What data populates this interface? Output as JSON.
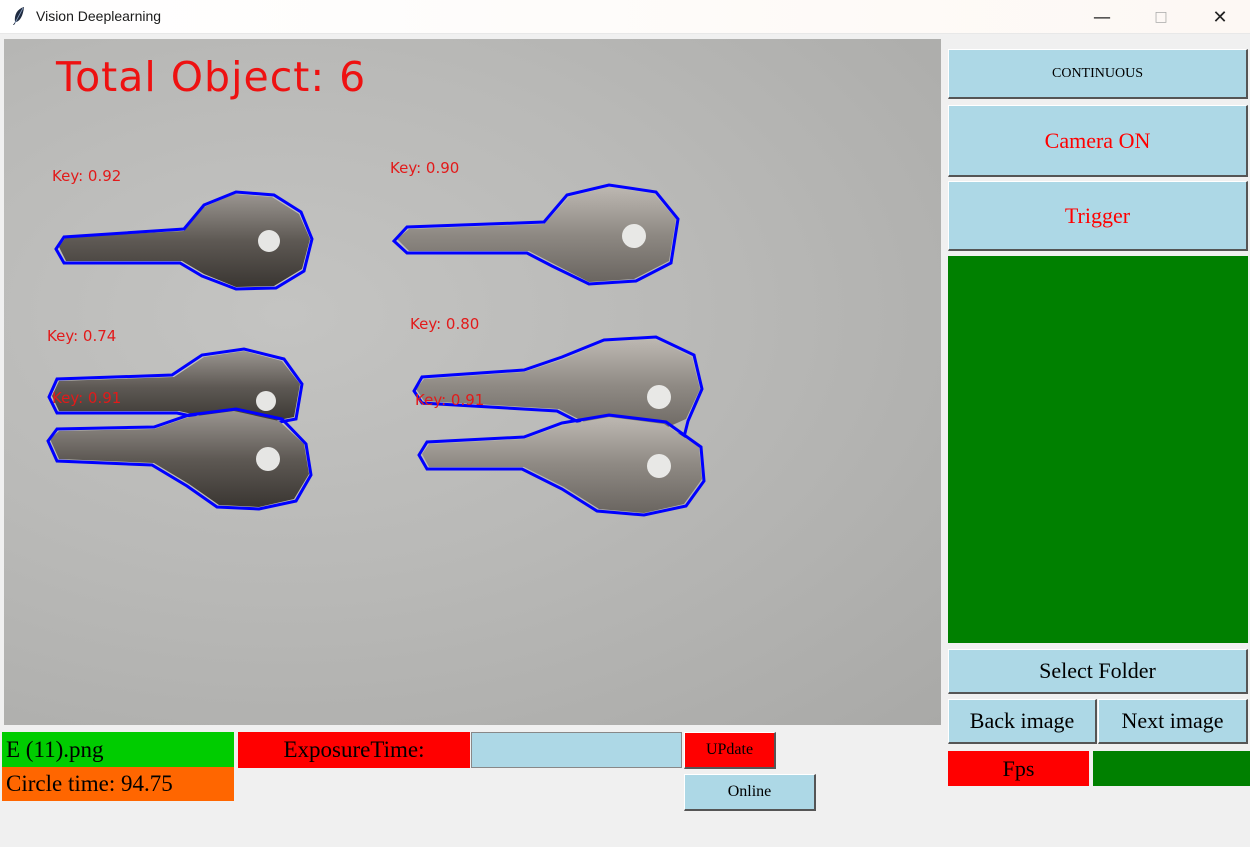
{
  "window": {
    "title": "Vision Deeplearning",
    "minimize_glyph": "—",
    "maximize_glyph": "□",
    "close_glyph": "✕"
  },
  "camera_view": {
    "total_object_text": "Total Object: 6",
    "detections": [
      {
        "label": "Key: 0.92"
      },
      {
        "label": "Key: 0.90"
      },
      {
        "label": "Key: 0.74"
      },
      {
        "label": "Key: 0.80"
      },
      {
        "label": "Key: 0.91"
      },
      {
        "label": "Key: 0.91"
      }
    ],
    "label_color": "#e21a1a",
    "contour_color": "#0000ff"
  },
  "right_panel": {
    "continuous_label": "CONTINUOUS",
    "camera_on_label": "Camera ON",
    "trigger_label": "Trigger",
    "select_folder_label": "Select Folder",
    "back_image_label": "Back image",
    "next_image_label": "Next image",
    "fps_label": "Fps",
    "fps_value": ""
  },
  "bottom_bar": {
    "filename": "E (11).png",
    "circle_time": "Circle time: 94.75",
    "exposure_label": "ExposureTime:",
    "exposure_value": "",
    "update_label": "UPdate",
    "online_label": "Online"
  },
  "colors": {
    "button_bg": "#add8e6",
    "status_green": "#008000",
    "filename_green": "#00cc00",
    "alert_red": "#ff0000",
    "time_orange": "#ff6600"
  }
}
